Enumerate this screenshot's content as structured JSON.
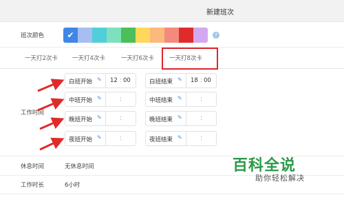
{
  "window": {
    "title": "新建班次"
  },
  "color_row": {
    "label": "班次颜色",
    "swatches": [
      "#3f87e6",
      "#a7bef2",
      "#4fd0d8",
      "#7fe0be",
      "#4cbf5a",
      "#ffd75a",
      "#fcb97b",
      "#f48a7e",
      "#e02b2b",
      "#d3a8f0"
    ],
    "selected_index": 0,
    "check_icon": "checkmark-icon",
    "help_icon": "help-icon"
  },
  "tabs": [
    {
      "label": "一天打2次卡"
    },
    {
      "label": "一天打4次卡"
    },
    {
      "label": "一天打6次卡"
    },
    {
      "label": "一天打8次卡",
      "highlighted": true
    }
  ],
  "work_time": {
    "label": "工作时间",
    "shifts": [
      {
        "start_label": "白班开始",
        "start_h": "12",
        "start_m": "00",
        "end_label": "白班结束",
        "end_h": "18",
        "end_m": "00"
      },
      {
        "start_label": "中班开始",
        "start_h": "",
        "start_m": "",
        "end_label": "中班结束",
        "end_h": "",
        "end_m": ""
      },
      {
        "start_label": "晚班开始",
        "start_h": "",
        "start_m": "",
        "end_label": "晚班结束",
        "end_h": "",
        "end_m": ""
      },
      {
        "start_label": "夜班开始",
        "start_h": "",
        "start_m": "",
        "end_label": "夜班结束",
        "end_h": "",
        "end_m": ""
      }
    ],
    "colon": ":",
    "pencil_icon": "pencil-icon"
  },
  "rest_time": {
    "label": "休息时间",
    "value": "无休息时间"
  },
  "work_duration": {
    "label": "工作时长",
    "value": "6小时"
  },
  "watermark": {
    "line1": "百科全说",
    "line2": "助你轻松解决"
  },
  "annotation_color": "#e02b2b"
}
